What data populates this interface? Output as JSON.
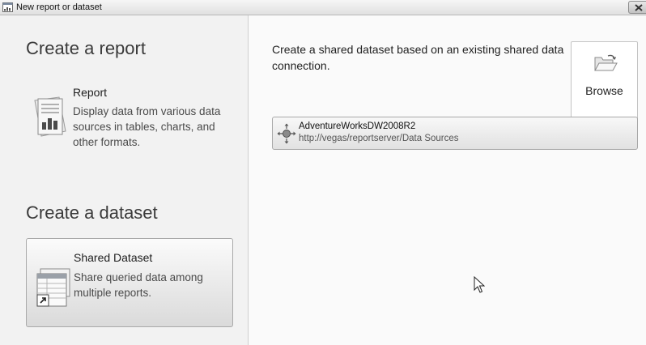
{
  "window": {
    "title": "New report or dataset",
    "close_icon": "close-icon",
    "app_icon": "report-window-icon"
  },
  "left_panel": {
    "create_report_heading": "Create a report",
    "report_option": {
      "icon": "report-icon",
      "title": "Report",
      "description": "Display data from various data sources in tables, charts, and other formats."
    },
    "create_dataset_heading": "Create a dataset",
    "dataset_option": {
      "icon": "shared-dataset-icon",
      "title": "Shared Dataset",
      "description": "Share queried data among multiple reports.",
      "selected": true
    }
  },
  "right_panel": {
    "instruction": "Create a shared dataset based on an existing shared data connection.",
    "browse_button": {
      "icon": "folder-open-icon",
      "label": "Browse"
    },
    "connections": [
      {
        "icon": "data-source-icon",
        "name": "AdventureWorksDW2008R2",
        "path": "http://vegas/reportserver/Data Sources"
      }
    ]
  },
  "cursor": {
    "icon": "mouse-pointer-icon"
  },
  "colors": {
    "left_panel_bg": "#f2f2f2",
    "right_panel_bg": "#fafafa",
    "heading_text": "#3a3a3a",
    "border": "#a9a9a9"
  }
}
